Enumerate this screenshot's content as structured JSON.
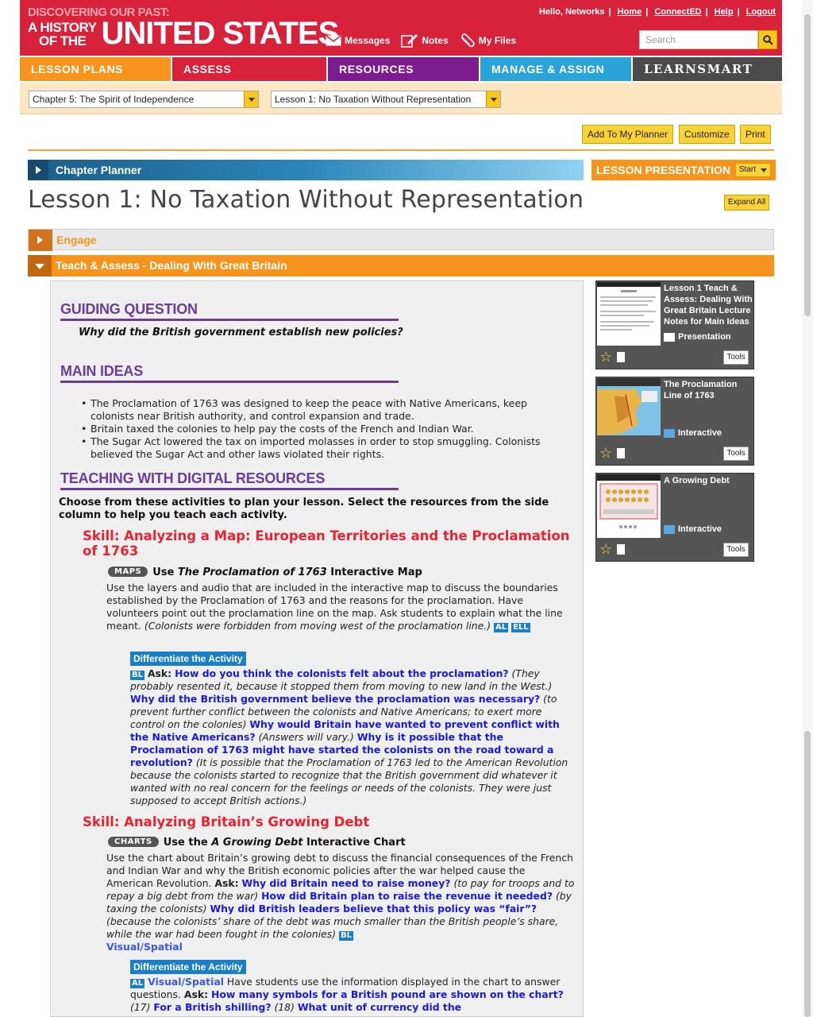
{
  "header": {
    "logo_line1": "DISCOVERING OUR PAST:",
    "logo_line2a": "A HISTORY",
    "logo_line2b": "OF THE",
    "logo_line3": "UNITED STATES",
    "greeting": "Hello, Networks",
    "links": [
      "Home",
      "ConnectED",
      "Help",
      "Logout"
    ],
    "tools": [
      {
        "label": "Messages",
        "icon": "envelope-icon"
      },
      {
        "label": "Notes",
        "icon": "pencil-note-icon"
      },
      {
        "label": "My Files",
        "icon": "paperclip-icon"
      }
    ],
    "search_placeholder": "Search",
    "brand_color": "#d8213b"
  },
  "nav": {
    "tabs": [
      "LESSON PLANS",
      "ASSESS",
      "RESOURCES",
      "MANAGE & ASSIGN",
      "LEARNSMART"
    ],
    "colors": [
      "#f7941d",
      "#d8213b",
      "#7d1c8c",
      "#2aa3d8",
      "#4b4b4b"
    ]
  },
  "selectors": {
    "chapter": "Chapter 5: The Spirit of Independence",
    "lesson": "Lesson 1: No Taxation Without Representation"
  },
  "actions": {
    "planner": "Add To My Planner",
    "customize": "Customize",
    "print": "Print"
  },
  "chapter_planner": "Chapter Planner",
  "lesson_presentation": {
    "label": "LESSON PRESENTATION",
    "start": "Start"
  },
  "lesson_title": "Lesson 1: No Taxation Without Representation",
  "expand_all": "Expand All",
  "sections": {
    "engage": "Engage",
    "teach": "Teach & Assess - Dealing With Great Britain"
  },
  "content": {
    "guiding_heading": "GUIDING QUESTION",
    "guiding_question": "Why did the British government establish new policies?",
    "main_ideas_heading": "MAIN IDEAS",
    "main_ideas": [
      "The Proclamation of 1763 was designed to keep the peace with Native Americans, keep colonists near British authority, and control expansion and trade.",
      "Britain taxed the colonies to help pay the costs of the French and Indian War.",
      "The Sugar Act lowered the tax on imported molasses in order to stop smuggling. Colonists believed the Sugar Act and other laws violated their rights."
    ],
    "digital_heading": "TEACHING WITH DIGITAL RESOURCES",
    "choose_text": "Choose from these activities to plan your lesson. Select the resources from the side column to help you teach each activity.",
    "skill1": "Skill: Analyzing a Map: European Territories and the Proclamation of 1763",
    "skill1_pill": "MAPS",
    "skill1_use_a": "Use ",
    "skill1_use_b": "The Proclamation of 1763",
    "skill1_use_c": " Interactive Map",
    "skill1_para": "Use the layers and audio that are included in the interactive map to discuss the boundaries established by the Proclamation of 1763 and the reasons for the proclamation. Have volunteers point out the proclamation line on the map. Ask students to explain what the line meant.",
    "skill1_para_ans": "(Colonists were forbidden from moving west of the proclamation line.)",
    "tag_al": "AL",
    "tag_ell": "ELL",
    "tag_bl": "BL",
    "differentiate": "Differentiate the Activity",
    "ask_label": "Ask:",
    "d1_q1": "How do you think the colonists felt about the proclamation?",
    "d1_a1": "(They probably resented it, because it stopped them from moving to new land in the West.)",
    "d1_q2": "Why did the British government believe the proclamation was necessary?",
    "d1_a2": "(to prevent further conflict between the colonists and Native Americans; to exert more control on the colonies)",
    "d1_q3": "Why would Britain have wanted to prevent conflict with the Native Americans?",
    "d1_a3": "(Answers will vary.)",
    "d1_q4": "Why is it possible that the Proclamation of 1763 might have started the colonists on the road toward a revolution?",
    "d1_a4": "(It is possible that the Proclamation of 1763 led to the American Revolution because the colonists started to recognize that the British government did whatever it wanted with no real concern for the feelings or needs of the colonists. They were just supposed to accept British actions.)",
    "skill2": "Skill: Analyzing Britain’s Growing Debt",
    "skill2_pill": "CHARTS",
    "skill2_use_a": "Use the ",
    "skill2_use_b": "A Growing Debt",
    "skill2_use_c": " Interactive Chart",
    "skill2_para": "Use the chart about Britain’s growing debt to discuss the financial consequences of the French and Indian War and why the British economic policies after the war helped cause the American Revolution.",
    "s2_q1": "Why did Britain need to raise money?",
    "s2_a1": "(to pay for troops and to repay a big debt from the war)",
    "s2_q2": "How did Britain plan to raise the revenue it needed?",
    "s2_a2": "(by taxing the colonists)",
    "s2_q3": "Why did British leaders believe that this policy was “fair”?",
    "s2_a3": "(because the colonists’ share of the debt was much smaller than the British people’s share, while the war had been fought in the colonies)",
    "visual_spatial": "Visual/Spatial",
    "d2_text": "Have students use the information displayed in the chart to answer questions.",
    "d2_q1": "How many symbols for a British pound are shown on the chart?",
    "d2_a1": "(17)",
    "d2_q2": "For a British shilling?",
    "d2_a2": "(18)",
    "d2_q3": "What unit of currency did the"
  },
  "resources": [
    {
      "title": "Lesson 1 Teach & Assess: Dealing With Great Britain Lecture Notes for Main Ideas",
      "type": "Presentation",
      "tools": "Tools"
    },
    {
      "title": "The Proclamation Line of 1763",
      "type": "Interactive",
      "tools": "Tools"
    },
    {
      "title": "A Growing Debt",
      "type": "Interactive",
      "tools": "Tools"
    }
  ]
}
